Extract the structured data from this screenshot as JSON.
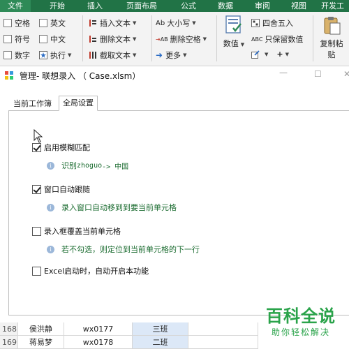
{
  "ribbon": {
    "tabs": [
      "文件",
      "开始",
      "插入",
      "页面布局",
      "公式",
      "数据",
      "审阅",
      "视图",
      "开发工"
    ],
    "col1": [
      "空格",
      "符号",
      "数字"
    ],
    "col2": [
      "英文",
      "中文",
      "执行"
    ],
    "col3": [
      "插入文本",
      "删除文本",
      "截取文本"
    ],
    "col4": [
      "大小写",
      "删除空格",
      "更多"
    ],
    "col4_icons": [
      "Ab",
      "AB",
      ""
    ],
    "numeric_label": "数值",
    "col5": [
      "四舍五入",
      "只保留数值"
    ],
    "col5_icons": [
      "",
      "ABC"
    ],
    "col5_plus": "+",
    "copy_paste_label": "复制粘",
    "copy_paste_label2": "贴"
  },
  "dialog": {
    "title": "管理- 联想录入 （ Case.xlsm）",
    "tabs": [
      "当前工作簿",
      "全局设置"
    ],
    "options": [
      {
        "label": "启用模糊匹配",
        "checked": true,
        "hint_pre": "识别",
        "hint_code": "zhoguo",
        "hint_post": " -> 中国"
      },
      {
        "label": "窗口自动跟随",
        "checked": true,
        "hint_pre": "录入窗口自动移到到要当前单元格",
        "hint_code": "",
        "hint_post": ""
      },
      {
        "label": "录入框覆盖当前单元格",
        "checked": false,
        "hint_pre": "若不勾选，则定位到当前单元格的下一行",
        "hint_code": "",
        "hint_post": ""
      },
      {
        "label": "Excel启动时，自动开启本功能",
        "checked": false
      }
    ]
  },
  "sheet": {
    "rows": [
      {
        "num": "168",
        "name": "侯洪静",
        "code": "wx0177",
        "class": "三班"
      },
      {
        "num": "169",
        "name": "蒋易梦",
        "code": "wx0178",
        "class": "二班"
      }
    ]
  },
  "watermark": {
    "title": "百科全说",
    "subtitle": "助你轻松解决"
  },
  "colors": {
    "ribbon_green": "#217346",
    "hint_green": "#1a6b2f",
    "watermark_green": "#2aa34a",
    "cell_blue": "#dce8f7"
  }
}
